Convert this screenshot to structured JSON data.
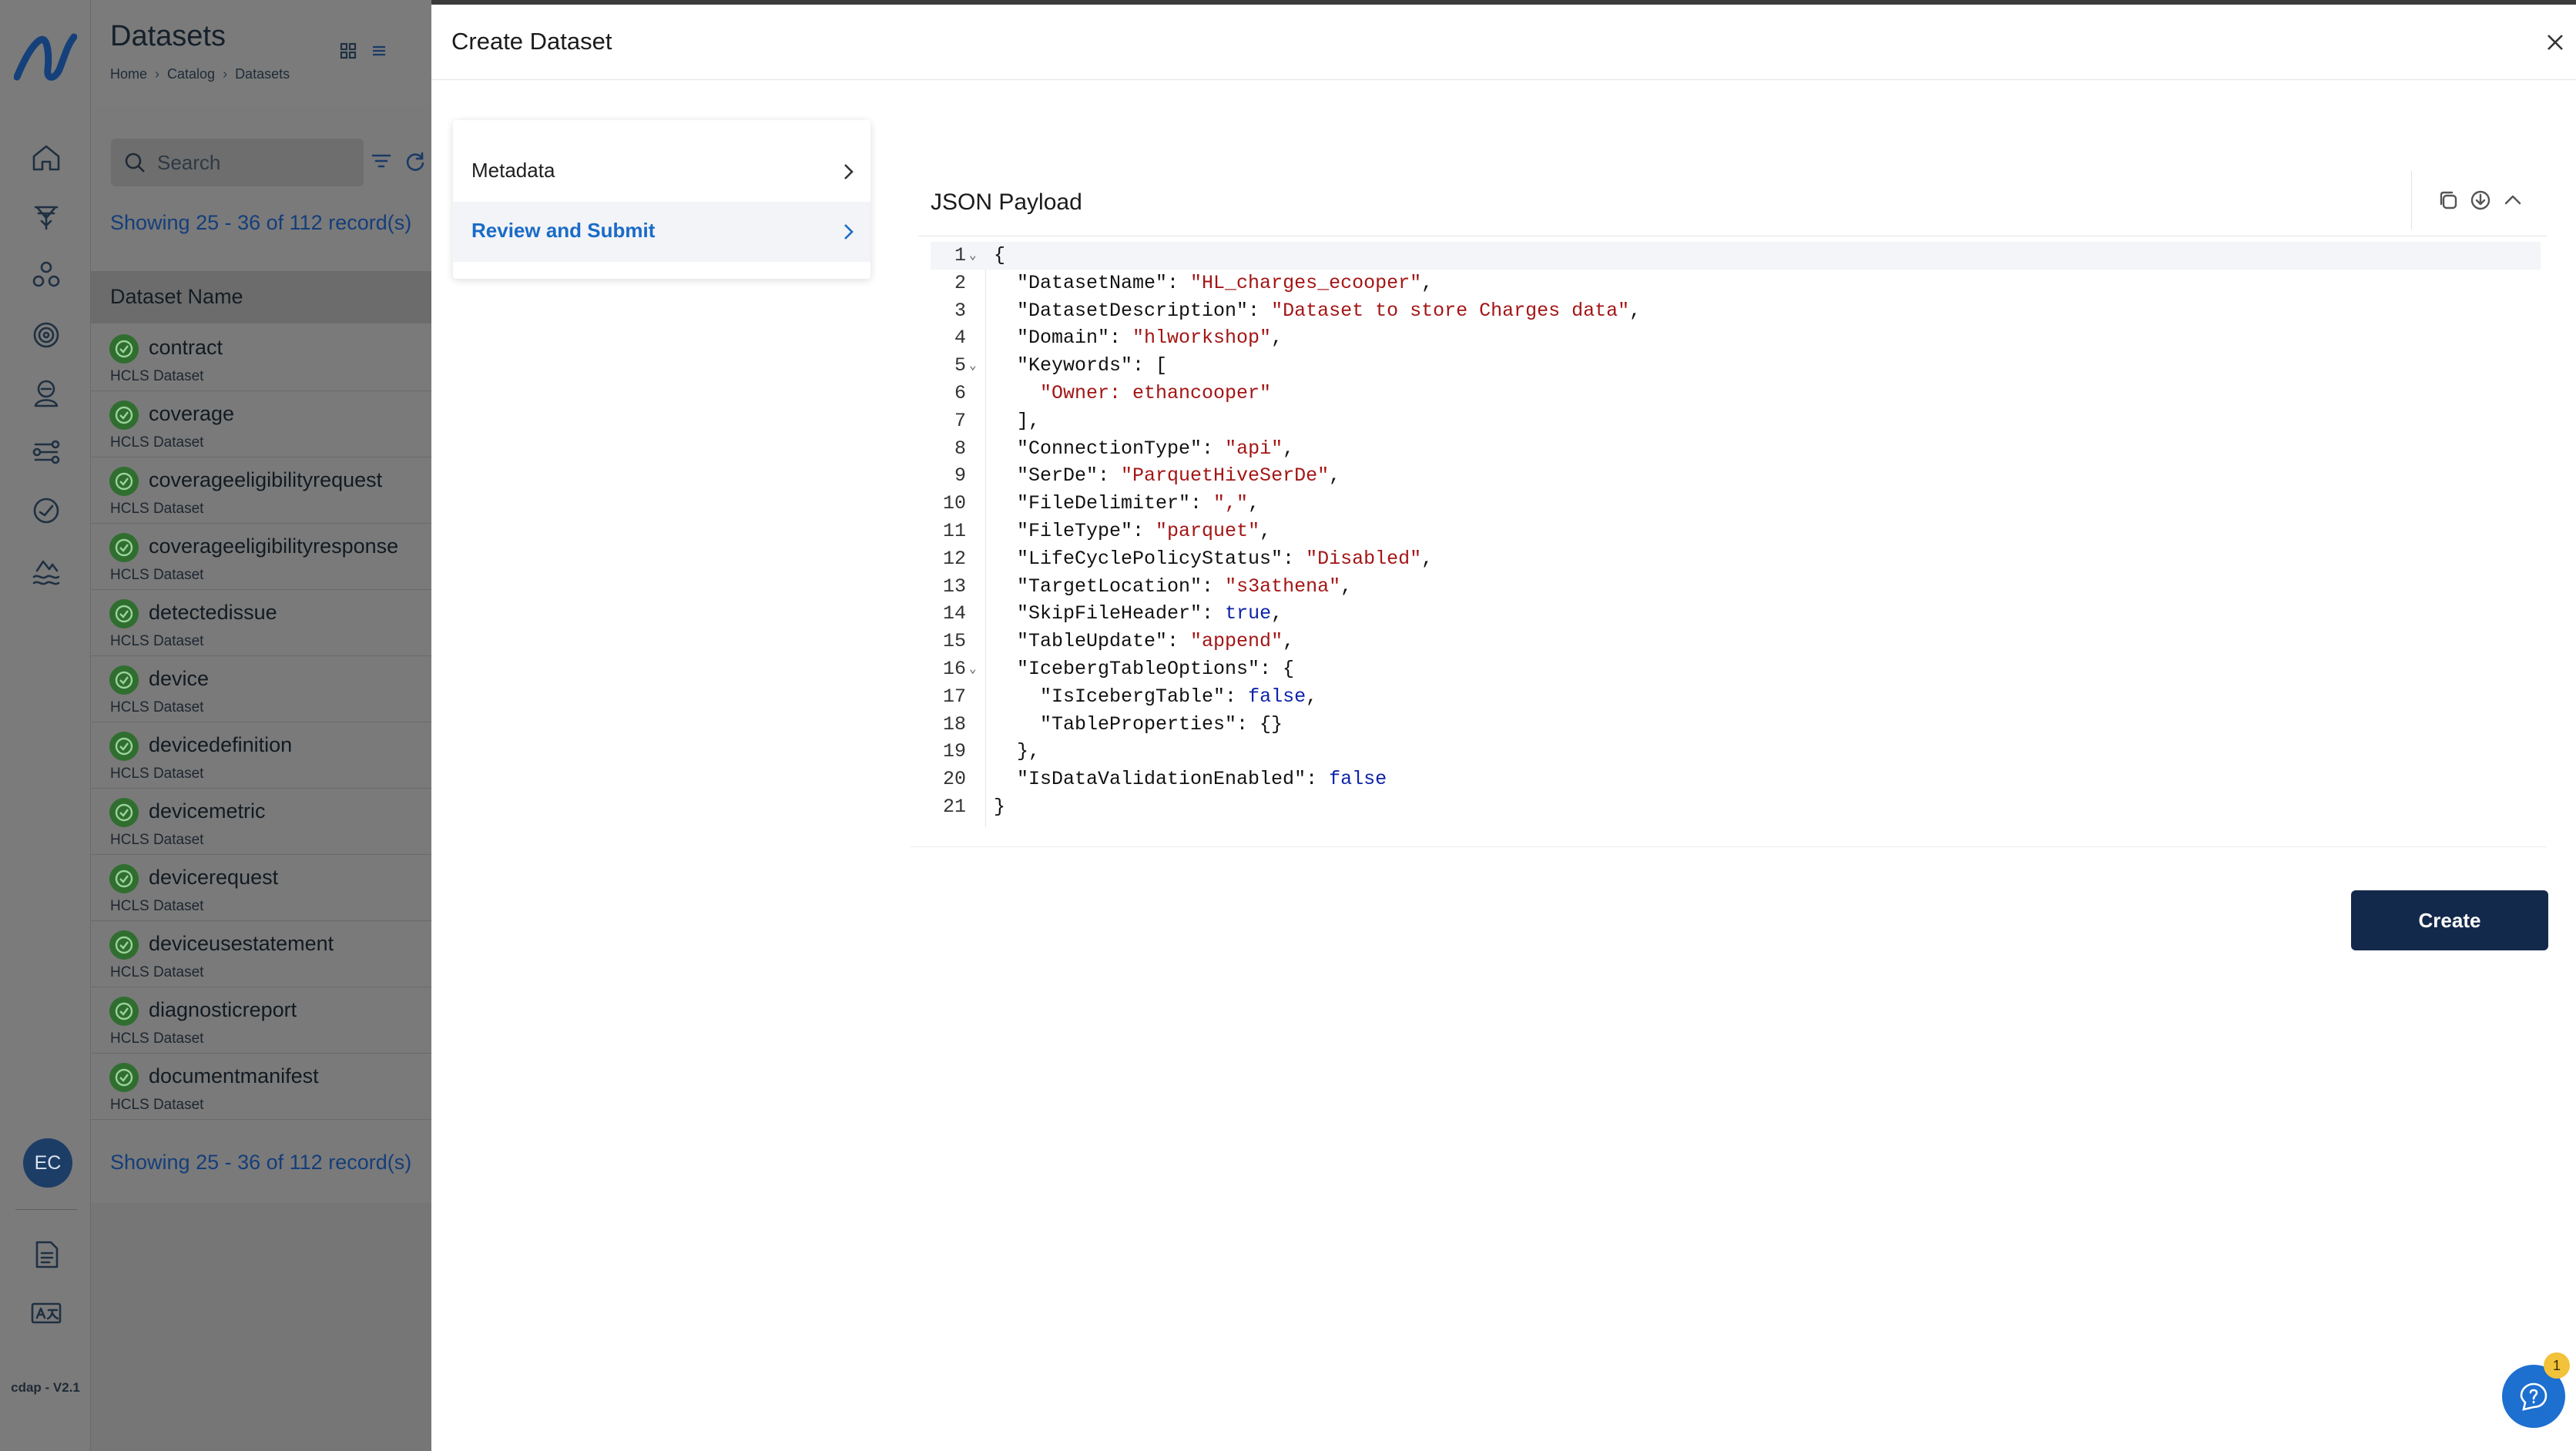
{
  "app": {
    "version": "cdap - V2.1",
    "user_initials": "EC"
  },
  "sidebar_nav": [
    {
      "icon": "home-icon"
    },
    {
      "icon": "ingestion-icon"
    },
    {
      "icon": "groups-icon"
    },
    {
      "icon": "target-icon"
    },
    {
      "icon": "governance-icon"
    },
    {
      "icon": "pipeline-icon"
    },
    {
      "icon": "monitor-icon"
    },
    {
      "icon": "lake-icon"
    }
  ],
  "sidebar_bottom": [
    {
      "icon": "document-icon"
    },
    {
      "icon": "translate-icon"
    }
  ],
  "list_panel": {
    "title": "Datasets",
    "breadcrumb": [
      "Home",
      "Catalog",
      "Datasets"
    ],
    "search_placeholder": "Search",
    "records_text": "Showing 25 - 36 of 112 record(s)",
    "column_header": "Dataset Name",
    "items": [
      {
        "name": "contract",
        "type": "HCLS Dataset"
      },
      {
        "name": "coverage",
        "type": "HCLS Dataset"
      },
      {
        "name": "coverageeligibilityrequest",
        "type": "HCLS Dataset"
      },
      {
        "name": "coverageeligibilityresponse",
        "type": "HCLS Dataset"
      },
      {
        "name": "detectedissue",
        "type": "HCLS Dataset"
      },
      {
        "name": "device",
        "type": "HCLS Dataset"
      },
      {
        "name": "devicedefinition",
        "type": "HCLS Dataset"
      },
      {
        "name": "devicemetric",
        "type": "HCLS Dataset"
      },
      {
        "name": "devicerequest",
        "type": "HCLS Dataset"
      },
      {
        "name": "deviceusestatement",
        "type": "HCLS Dataset"
      },
      {
        "name": "diagnosticreport",
        "type": "HCLS Dataset"
      },
      {
        "name": "documentmanifest",
        "type": "HCLS Dataset"
      }
    ]
  },
  "dialog": {
    "title": "Create Dataset",
    "steps": [
      {
        "label": "Metadata",
        "active": false
      },
      {
        "label": "Review and Submit",
        "active": true
      }
    ],
    "json_panel_title": "JSON Payload",
    "create_label": "Create",
    "help_badge_count": "1",
    "json_lines": [
      {
        "n": "1",
        "fold": true,
        "text": "{"
      },
      {
        "n": "2",
        "fold": false,
        "text": "  \"DatasetName\": \"HL_charges_ecooper\","
      },
      {
        "n": "3",
        "fold": false,
        "text": "  \"DatasetDescription\": \"Dataset to store Charges data\","
      },
      {
        "n": "4",
        "fold": false,
        "text": "  \"Domain\": \"hlworkshop\","
      },
      {
        "n": "5",
        "fold": true,
        "text": "  \"Keywords\": ["
      },
      {
        "n": "6",
        "fold": false,
        "text": "    \"Owner: ethancooper\""
      },
      {
        "n": "7",
        "fold": false,
        "text": "  ],"
      },
      {
        "n": "8",
        "fold": false,
        "text": "  \"ConnectionType\": \"api\","
      },
      {
        "n": "9",
        "fold": false,
        "text": "  \"SerDe\": \"ParquetHiveSerDe\","
      },
      {
        "n": "10",
        "fold": false,
        "text": "  \"FileDelimiter\": \",\","
      },
      {
        "n": "11",
        "fold": false,
        "text": "  \"FileType\": \"parquet\","
      },
      {
        "n": "12",
        "fold": false,
        "text": "  \"LifeCyclePolicyStatus\": \"Disabled\","
      },
      {
        "n": "13",
        "fold": false,
        "text": "  \"TargetLocation\": \"s3athena\","
      },
      {
        "n": "14",
        "fold": false,
        "text": "  \"SkipFileHeader\": true,"
      },
      {
        "n": "15",
        "fold": false,
        "text": "  \"TableUpdate\": \"append\","
      },
      {
        "n": "16",
        "fold": true,
        "text": "  \"IcebergTableOptions\": {"
      },
      {
        "n": "17",
        "fold": false,
        "text": "    \"IsIcebergTable\": false,"
      },
      {
        "n": "18",
        "fold": false,
        "text": "    \"TableProperties\": {}"
      },
      {
        "n": "19",
        "fold": false,
        "text": "  },"
      },
      {
        "n": "20",
        "fold": false,
        "text": "  \"IsDataValidationEnabled\": false"
      },
      {
        "n": "21",
        "fold": false,
        "text": "}"
      }
    ]
  },
  "colors": {
    "primary_button": "#13294b",
    "active_step": "#1a6bc7",
    "json_string": "#a31515",
    "json_keyword": "#0d22aa",
    "help_button": "#1d6fd0",
    "badge": "#f2c23a"
  }
}
